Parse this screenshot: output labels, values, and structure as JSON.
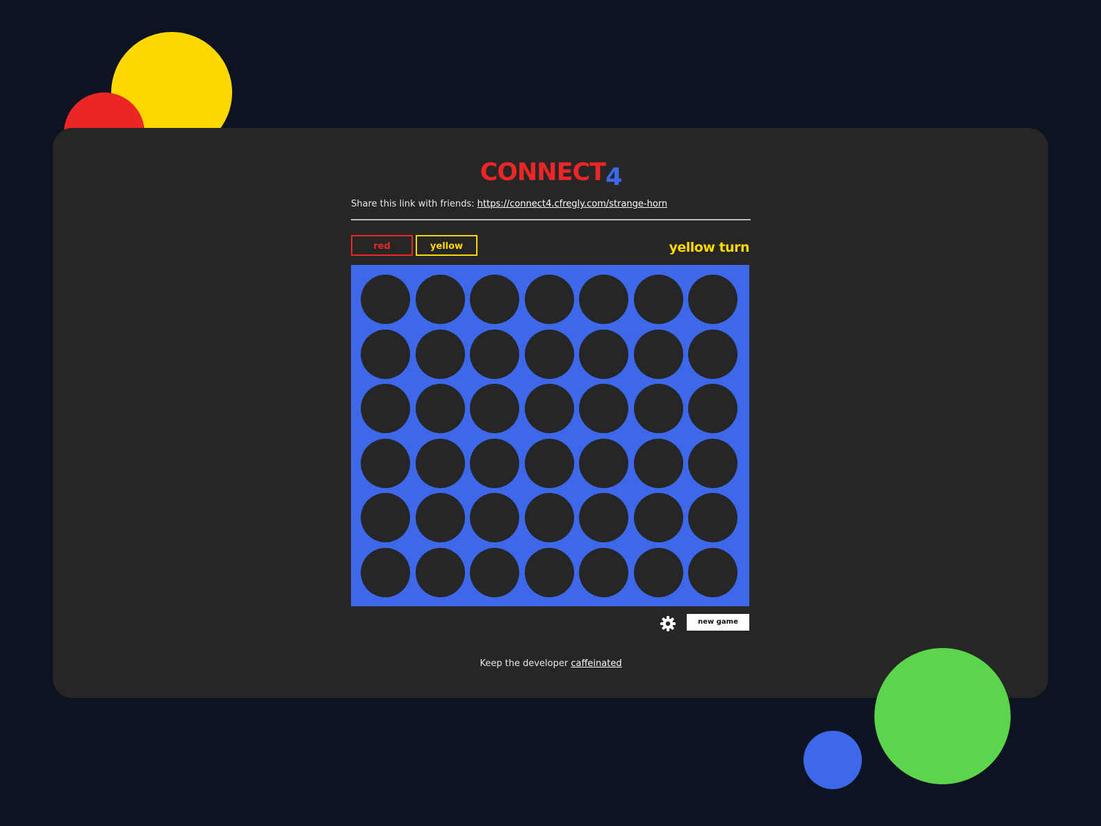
{
  "colors": {
    "background": "#0d1321",
    "card": "#262626",
    "red": "#ea2626",
    "yellow": "#ffd800",
    "blue": "#3d68ea",
    "green": "#5bd54b",
    "empty_cell": "#262626"
  },
  "logo": {
    "part1": "CONNECT",
    "part2": "4"
  },
  "share": {
    "prefix": "Share this link with friends:",
    "link": "https://connect4.cfregly.com/strange-horn"
  },
  "players": {
    "red_label": "red",
    "yellow_label": "yellow"
  },
  "status": {
    "turn_text": "yellow turn"
  },
  "board": {
    "rows": 6,
    "columns": 7,
    "cells": [
      [
        "empty",
        "empty",
        "empty",
        "empty",
        "empty",
        "empty",
        "empty"
      ],
      [
        "empty",
        "empty",
        "empty",
        "empty",
        "empty",
        "empty",
        "empty"
      ],
      [
        "empty",
        "empty",
        "empty",
        "empty",
        "empty",
        "empty",
        "empty"
      ],
      [
        "empty",
        "empty",
        "empty",
        "empty",
        "empty",
        "empty",
        "empty"
      ],
      [
        "empty",
        "empty",
        "empty",
        "empty",
        "empty",
        "empty",
        "empty"
      ],
      [
        "empty",
        "empty",
        "empty",
        "empty",
        "empty",
        "empty",
        "empty"
      ]
    ]
  },
  "controls": {
    "settings_icon": "gear-icon",
    "new_game_label": "new game"
  },
  "footer": {
    "prefix": "Keep the developer",
    "link": "caffeinated"
  }
}
